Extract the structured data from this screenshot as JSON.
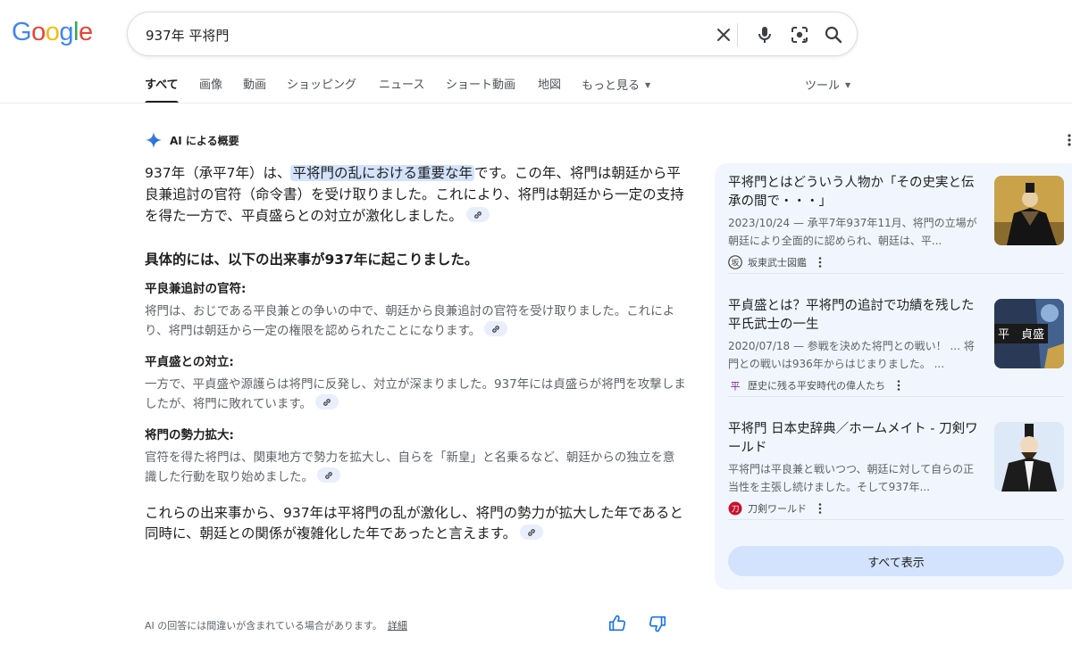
{
  "logo": {
    "letters": [
      "G",
      "o",
      "o",
      "g",
      "l",
      "e"
    ]
  },
  "search": {
    "query": "937年 平将門"
  },
  "tabs": [
    "すべて",
    "画像",
    "動画",
    "ショッピング",
    "ニュース",
    "ショート動画",
    "地図",
    "もっと見る"
  ],
  "tools_label": "ツール",
  "ai": {
    "title": "AI による概要",
    "lead_before": "937年（承平7年）は、",
    "lead_highlight": "平将門の乱における重要な年",
    "lead_after": "です。この年、将門は朝廷から平良兼追討の官符（命令書）を受け取りました。これにより、将門は朝廷から一定の支持を得た一方で、平貞盛らとの対立が激化しました。",
    "subheading": "具体的には、以下の出来事が937年に起こりました。",
    "items": [
      {
        "title": "平良兼追討の官符:",
        "body": "将門は、おじである平良兼との争いの中で、朝廷から良兼追討の官符を受け取りました。これにより、将門は朝廷から一定の権限を認められたことになります。"
      },
      {
        "title": "平貞盛との対立:",
        "body": "一方で、平貞盛や源護らは将門に反発し、対立が深まりました。937年には貞盛らが将門を攻撃しましたが、将門に敗れています。"
      },
      {
        "title": "将門の勢力拡大:",
        "body": "官符を得た将門は、関東地方で勢力を拡大し、自らを「新皇」と名乗るなど、朝廷からの独立を意識した行動を取り始めました。"
      }
    ],
    "conclusion": "これらの出来事から、937年は平将門の乱が激化し、将門の勢力が拡大した年であると同時に、朝廷との関係が複雑化した年であったと言えます。",
    "disclaimer": "AI の回答には間違いが含まれている場合があります。",
    "details_link": "詳細"
  },
  "sources": [
    {
      "title": "平将門とはどういう人物か「その史実と伝承の間で・・・」",
      "snippet": "2023/10/24 — 承平7年937年11月、将門の立場が朝廷により全面的に認められ、朝廷は、平...",
      "site": "坂東武士図鑑",
      "fav_text": "坂"
    },
    {
      "title": "平貞盛とは？平将門の追討で功績を残した平氏武士の一生",
      "snippet": "2020/07/18 — 参戦を決めた将門との戦い！ ... 将門との戦いは936年からはじまりました。 ...",
      "site": "歴史に残る平安時代の偉人たち",
      "fav_text": "平",
      "thumb_caption": "平　貞盛"
    },
    {
      "title": "平将門 日本史辞典／ホームメイト - 刀剣ワールド",
      "snippet": "平将門は平良兼と戦いつつ、朝廷に対して自らの正当性を主張し続けました。そして937年...",
      "site": "刀剣ワールド",
      "fav_text": "刀"
    }
  ],
  "show_all": "すべて表示",
  "colors": {
    "accent": "#1a73e8",
    "panel": "#f1f6fe",
    "highlight": "#d3e3fd",
    "muted_text": "#5f6368"
  }
}
